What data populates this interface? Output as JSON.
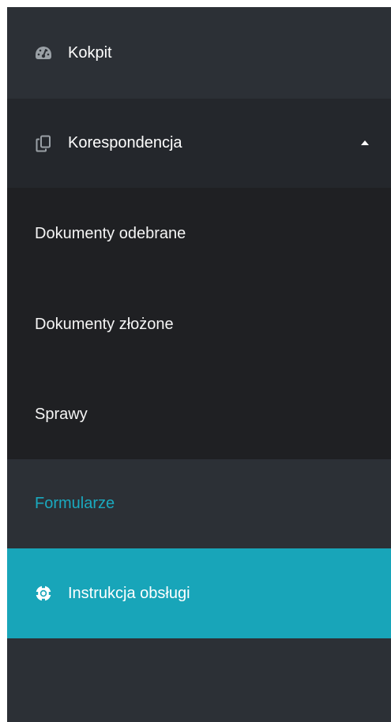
{
  "sidebar": {
    "kokpit": {
      "label": "Kokpit",
      "icon": "dashboard-gauge-icon"
    },
    "korespondencja": {
      "label": "Korespondencja",
      "icon": "copy-documents-icon",
      "expanded": true,
      "children": [
        {
          "label": "Dokumenty odebrane"
        },
        {
          "label": "Dokumenty złożone"
        },
        {
          "label": "Sprawy"
        }
      ]
    },
    "formularze": {
      "label": "Formularze"
    },
    "instrukcja": {
      "label": "Instrukcja obsługi",
      "icon": "life-ring-icon",
      "active": true
    }
  },
  "colors": {
    "sidebar_bg": "#2c3036",
    "submenu_bg": "#1f2023",
    "active_bg": "#18a5b9",
    "link_accent": "#1aa9bf"
  }
}
